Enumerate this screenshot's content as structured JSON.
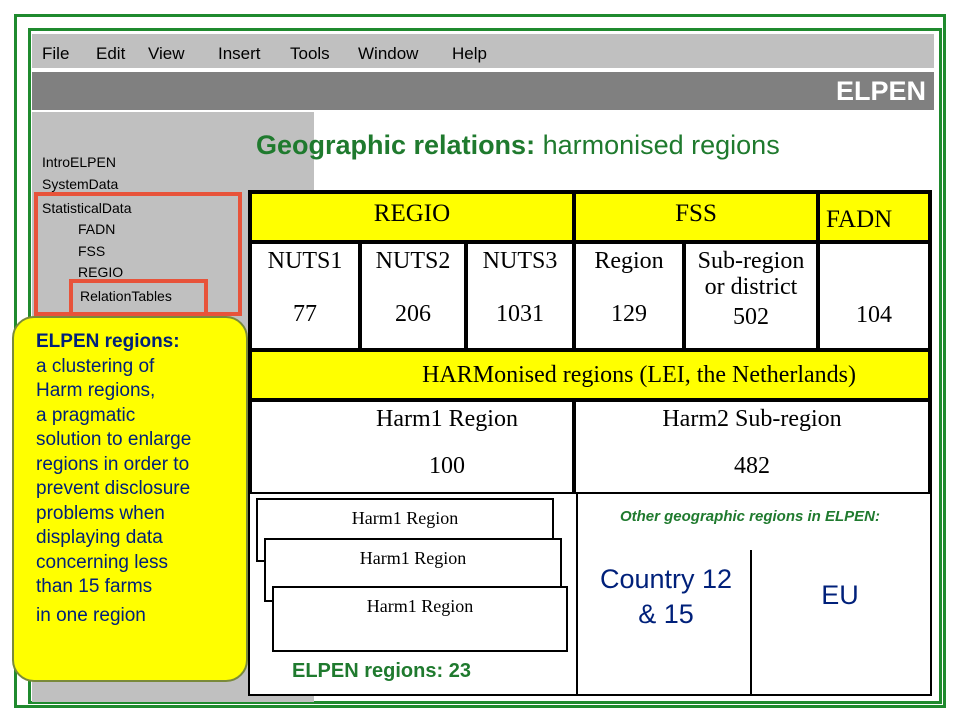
{
  "menu": [
    "File",
    "Edit",
    "View",
    "Insert",
    "Tools",
    "Window",
    "Help"
  ],
  "app_title": "ELPEN",
  "sidebar": {
    "items": [
      "IntroELPEN",
      "SystemData",
      "StatisticalData",
      "FADN",
      "FSS",
      "REGIO",
      "RelationTables"
    ],
    "selected": "RelationTables"
  },
  "heading": {
    "bold": "Geographic relations:",
    "rest": " harmonised regions"
  },
  "table": {
    "groups": [
      "REGIO",
      "FSS",
      "FADN"
    ],
    "levels": [
      {
        "name": "NUTS1",
        "count": "77"
      },
      {
        "name": "NUTS2",
        "count": "206"
      },
      {
        "name": "NUTS3",
        "count": "1031"
      },
      {
        "name": "Region",
        "count": "129"
      },
      {
        "name": "Sub-region or district",
        "count": "502"
      },
      {
        "name": "",
        "count": "104"
      }
    ],
    "harm_header": "HARMonised regions (LEI, the Netherlands)",
    "harm": [
      {
        "name": "Harm1 Region",
        "count": "100"
      },
      {
        "name": "Harm2 Sub-region",
        "count": "482"
      }
    ]
  },
  "bottom": {
    "stack_label": "Harm1 Region",
    "elpen_regions": "ELPEN regions: 23",
    "other_label": "Other geographic regions in ELPEN:",
    "country": "Country 12 & 15",
    "eu": "EU"
  },
  "callout": {
    "title": "ELPEN regions:",
    "lines": [
      "a clustering of",
      "Harm regions,",
      "a pragmatic",
      "solution to enlarge",
      "regions in order to",
      "prevent disclosure",
      "problems when",
      "displaying data",
      "concerning less",
      "than 15 farms",
      "in one region"
    ]
  },
  "colors": {
    "frame": "#1f8a2e",
    "heading": "#1f7a2e",
    "highlight": "#e8533a",
    "yellow": "#ffff00",
    "callout_text": "#00207a",
    "other_label": "#1f7a2e"
  }
}
